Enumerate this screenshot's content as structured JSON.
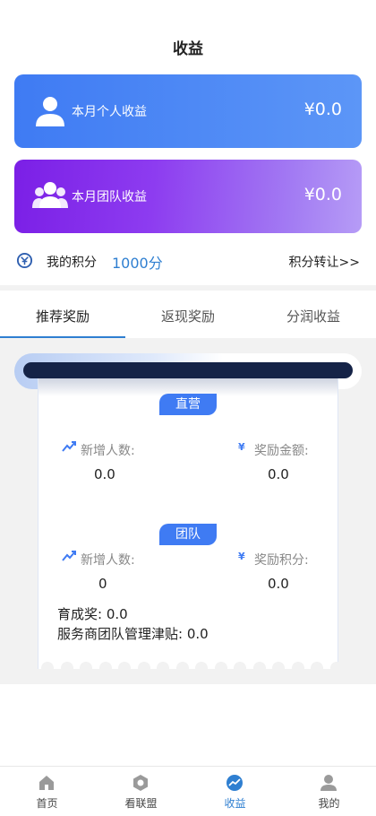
{
  "header": {
    "title": "收益"
  },
  "cards": {
    "personal": {
      "label": "本月个人收益",
      "amount": "¥0.0"
    },
    "team": {
      "label": "本月团队收益",
      "amount": "¥0.0"
    }
  },
  "points": {
    "label": "我的积分",
    "value": "1000分",
    "transfer": "积分转让>>"
  },
  "tabs": [
    {
      "label": "推荐奖励",
      "active": true
    },
    {
      "label": "返现奖励",
      "active": false
    },
    {
      "label": "分润收益",
      "active": false
    }
  ],
  "direct": {
    "badge": "直营",
    "new_users_label": "新增人数:",
    "new_users_value": "0.0",
    "reward_amount_label": "奖励金额:",
    "reward_amount_value": "0.0"
  },
  "team": {
    "badge": "团队",
    "new_users_label": "新增人数:",
    "new_users_value": "0",
    "reward_points_label": "奖励积分:",
    "reward_points_value": "0.0",
    "cultivation_bonus": "育成奖: 0.0",
    "management_allowance": "服务商团队管理津贴: 0.0"
  },
  "yen_symbol": "¥",
  "bottom_nav": [
    {
      "label": "首页",
      "icon": "home-icon"
    },
    {
      "label": "看联盟",
      "icon": "alliance-icon"
    },
    {
      "label": "收益",
      "icon": "earnings-icon",
      "active": true
    },
    {
      "label": "我的",
      "icon": "profile-icon"
    }
  ],
  "colors": {
    "accent": "#2f7fd1",
    "card_blue": "#3f7bf3",
    "card_purple": "#7b1fe6"
  }
}
